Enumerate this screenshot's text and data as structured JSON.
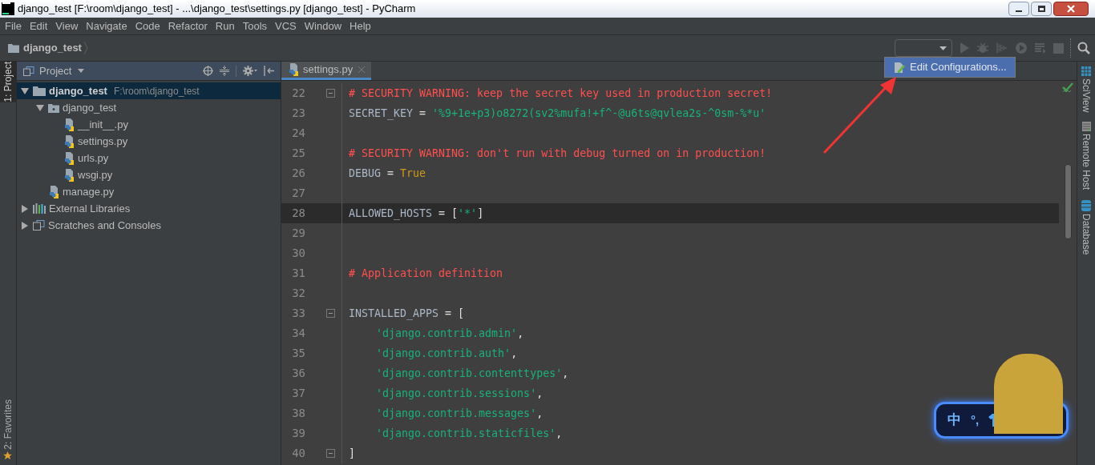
{
  "window": {
    "title": "django_test [F:\\room\\django_test] - ...\\django_test\\settings.py [django_test] - PyCharm"
  },
  "menu": [
    "File",
    "Edit",
    "View",
    "Navigate",
    "Code",
    "Refactor",
    "Run",
    "Tools",
    "VCS",
    "Window",
    "Help"
  ],
  "breadcrumb": "django_test",
  "run_popup": {
    "item": "Edit Configurations..."
  },
  "left_tool_tabs_top": [
    {
      "label": "1: Project",
      "selected": true
    }
  ],
  "left_tool_tabs_bottom": [
    {
      "label": "2: Favorites",
      "selected": false
    }
  ],
  "right_tool_tabs": [
    {
      "label": "SciView",
      "kind": "grid"
    },
    {
      "label": "Remote Host",
      "kind": "server"
    },
    {
      "label": "Database",
      "kind": "db"
    }
  ],
  "project_panel": {
    "title": "Project",
    "tree": [
      {
        "label": "django_test",
        "path": "F:\\room\\django_test",
        "kind": "folder",
        "expanded": true,
        "selected": true,
        "children": [
          {
            "label": "django_test",
            "kind": "package",
            "expanded": true,
            "selected": false,
            "children": [
              {
                "label": "__init__.py",
                "kind": "py",
                "selected": false
              },
              {
                "label": "settings.py",
                "kind": "py",
                "selected": false
              },
              {
                "label": "urls.py",
                "kind": "py",
                "selected": false
              },
              {
                "label": "wsgi.py",
                "kind": "py",
                "selected": false
              }
            ]
          },
          {
            "label": "manage.py",
            "kind": "py",
            "selected": false
          }
        ]
      },
      {
        "label": "External Libraries",
        "kind": "libs",
        "expanded": false,
        "selected": false
      },
      {
        "label": "Scratches and Consoles",
        "kind": "scratch",
        "expanded": false,
        "selected": false
      }
    ]
  },
  "editor": {
    "tabs": [
      {
        "label": "settings.py",
        "selected": true
      }
    ],
    "lines": [
      {
        "number": "22",
        "current": false,
        "fold": true,
        "indented": false,
        "tokens": [
          {
            "kind": "comment",
            "text": "# SECURITY WARNING: keep the secret key used in production secret!"
          }
        ]
      },
      {
        "number": "23",
        "current": false,
        "fold": false,
        "indented": false,
        "tokens": [
          {
            "kind": "name",
            "text": "SECRET_KEY"
          },
          {
            "kind": "op",
            "text": " = "
          },
          {
            "kind": "string",
            "text": "'%9+1e+p3)o8272(sv2%mufa!+f^-@u6ts@qvlea2s-^0sm-%*u'"
          }
        ]
      },
      {
        "number": "24",
        "current": false,
        "fold": false
      },
      {
        "number": "25",
        "current": false,
        "fold": false,
        "indented": false,
        "tokens": [
          {
            "kind": "comment",
            "text": "# SECURITY WARNING: don't run with debug turned on in production!"
          }
        ]
      },
      {
        "number": "26",
        "current": false,
        "fold": false,
        "indented": false,
        "tokens": [
          {
            "kind": "name",
            "text": "DEBUG"
          },
          {
            "kind": "op",
            "text": " = "
          },
          {
            "kind": "keyword",
            "text": "True"
          }
        ]
      },
      {
        "number": "27",
        "current": false,
        "fold": false
      },
      {
        "number": "28",
        "current": true,
        "fold": false,
        "indented": false,
        "tokens": [
          {
            "kind": "name",
            "text": "ALLOWED_HOSTS"
          },
          {
            "kind": "op",
            "text": " = ["
          },
          {
            "kind": "string",
            "text": "'*'"
          },
          {
            "kind": "op",
            "text": "]"
          }
        ]
      },
      {
        "number": "29",
        "current": false,
        "fold": false
      },
      {
        "number": "30",
        "current": false,
        "fold": false
      },
      {
        "number": "31",
        "current": false,
        "fold": false,
        "indented": false,
        "tokens": [
          {
            "kind": "comment",
            "text": "# Application definition"
          }
        ]
      },
      {
        "number": "32",
        "current": false,
        "fold": false
      },
      {
        "number": "33",
        "current": false,
        "fold": true,
        "indented": false,
        "tokens": [
          {
            "kind": "name",
            "text": "INSTALLED_APPS"
          },
          {
            "kind": "op",
            "text": " = ["
          }
        ]
      },
      {
        "number": "34",
        "current": false,
        "fold": false,
        "indented": true,
        "tokens": [
          {
            "kind": "string",
            "text": "'django.contrib.admin'"
          },
          {
            "kind": "op",
            "text": ","
          }
        ]
      },
      {
        "number": "35",
        "current": false,
        "fold": false,
        "indented": true,
        "tokens": [
          {
            "kind": "string",
            "text": "'django.contrib.auth'"
          },
          {
            "kind": "op",
            "text": ","
          }
        ]
      },
      {
        "number": "36",
        "current": false,
        "fold": false,
        "indented": true,
        "tokens": [
          {
            "kind": "string",
            "text": "'django.contrib.contenttypes'"
          },
          {
            "kind": "op",
            "text": ","
          }
        ]
      },
      {
        "number": "37",
        "current": false,
        "fold": false,
        "indented": true,
        "tokens": [
          {
            "kind": "string",
            "text": "'django.contrib.sessions'"
          },
          {
            "kind": "op",
            "text": ","
          }
        ]
      },
      {
        "number": "38",
        "current": false,
        "fold": false,
        "indented": true,
        "tokens": [
          {
            "kind": "string",
            "text": "'django.contrib.messages'"
          },
          {
            "kind": "op",
            "text": ","
          }
        ]
      },
      {
        "number": "39",
        "current": false,
        "fold": false,
        "indented": true,
        "tokens": [
          {
            "kind": "string",
            "text": "'django.contrib.staticfiles'"
          },
          {
            "kind": "op",
            "text": ","
          }
        ]
      },
      {
        "number": "40",
        "current": false,
        "fold": true,
        "indented": false,
        "tokens": [
          {
            "kind": "op",
            "text": "]"
          }
        ]
      }
    ]
  },
  "ime_widget": {
    "mode": "中",
    "punct": "°,"
  }
}
